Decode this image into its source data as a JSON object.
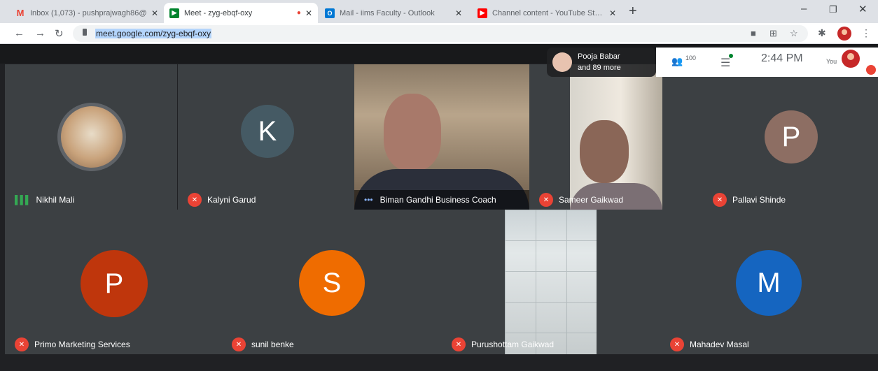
{
  "browser": {
    "tabs": [
      {
        "title": "Inbox (1,073) - pushprajwagh86@",
        "favicon": "gmail-icon",
        "color": "#ea4335"
      },
      {
        "title": "Meet - zyg-ebqf-oxy",
        "favicon": "meet-icon",
        "color": "#00832d"
      },
      {
        "title": "Mail - iims Faculty - Outlook",
        "favicon": "outlook-icon",
        "color": "#0078d4"
      },
      {
        "title": "Channel content - YouTube Studi",
        "favicon": "youtube-icon",
        "color": "#ff0000"
      }
    ],
    "url": "meet.google.com/zyg-ebqf-oxy"
  },
  "meet": {
    "people_pill": {
      "line1": "Pooja Babar",
      "line2": "and 89 more"
    },
    "participants_count": "100",
    "clock": "2:44 PM",
    "you_label": "You"
  },
  "participants": [
    {
      "name": "Nikhil Mali",
      "status": "speaking"
    },
    {
      "name": "Kalyni Garud",
      "initial": "K",
      "color": "#455a64",
      "status": "muted"
    },
    {
      "name": "Biman Gandhi Business Coach",
      "status": "more"
    },
    {
      "name": "Sameer Gaikwad",
      "status": "muted"
    },
    {
      "name": "Pallavi Shinde",
      "initial": "P",
      "color": "#8d6e63",
      "status": "muted"
    },
    {
      "name": "Primo Marketing Services",
      "initial": "P",
      "color": "#bf360c",
      "status": "muted"
    },
    {
      "name": "sunil benke",
      "initial": "S",
      "color": "#ef6c00",
      "status": "muted"
    },
    {
      "name": "Purushottam Gaikwad",
      "status": "muted"
    },
    {
      "name": "Mahadev Masal",
      "initial": "M",
      "color": "#1565c0",
      "status": "muted"
    }
  ]
}
